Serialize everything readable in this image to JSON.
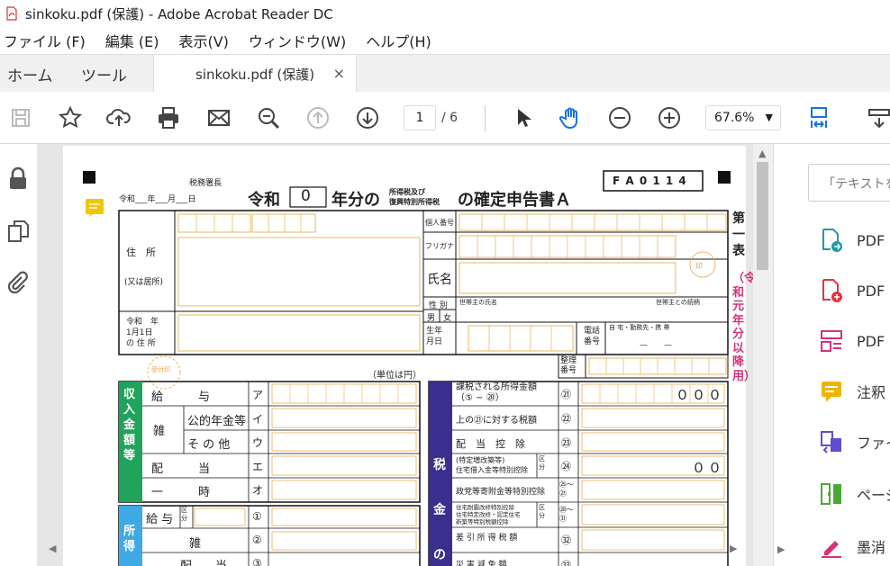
{
  "window": {
    "title": "sinkoku.pdf (保護) - Adobe Acrobat Reader DC"
  },
  "menu": [
    "ファイル (F)",
    "編集 (E)",
    "表示(V)",
    "ウィンドウ(W)",
    "ヘルプ(H)"
  ],
  "tabs": {
    "home": "ホーム",
    "tools": "ツール",
    "doc": "sinkoku.pdf (保護)",
    "close": "×"
  },
  "toolbar": {
    "page_current": "1",
    "page_total": "/ 6",
    "zoom": "67.6%",
    "zoom_arrow": "▼"
  },
  "right_panel": {
    "search_placeholder": "「テキストを",
    "items": [
      {
        "label": "PDF",
        "color": "#1e9aa6"
      },
      {
        "label": "PDF",
        "color": "#e0363f"
      },
      {
        "label": "PDF",
        "color": "#d6307a"
      },
      {
        "label": "注釈",
        "color": "#f0b400"
      },
      {
        "label": "ファイ",
        "color": "#5c4fcf"
      },
      {
        "label": "ページ",
        "color": "#4aa935"
      },
      {
        "label": "墨消",
        "color": "#d6307a"
      }
    ]
  },
  "form": {
    "code": "F A 0 1 1 4",
    "tax_office_head": "税務署長",
    "date_line": "令和___年___月___日",
    "title_reiwa": "令和",
    "title_year": "0",
    "title_main": "年分の",
    "title_small_1": "所得税及び",
    "title_small_2": "復興特別所得税",
    "title_end": "の確定申告書Ａ",
    "side_title": "第一表",
    "side_note": "（令和元年分以降用）",
    "address_label": "住　所",
    "address_sub": "(又は居所)",
    "jan1_label": "令和　年\n1月1日\nの 住 所",
    "mynumber": "個人番号",
    "furigana": "フリガナ",
    "name": "氏名",
    "sex": "性 別",
    "male": "男",
    "female": "女",
    "head_name": "世帯主の氏名",
    "relation": "世帯主との続柄",
    "birth": "生年\n月日",
    "phone": "電話\n番号",
    "phone_sub": "自 宅・勤務先・携 帯",
    "phone_dash": "—　　—",
    "seiri": "整理\n番号",
    "unit": "（単位は円）",
    "income_section": "収入金額等",
    "income_rows": [
      {
        "label": "給　　　与",
        "mark": "ア"
      },
      {
        "label": "公的年金等",
        "mark": "イ"
      },
      {
        "label": "そ の 他",
        "mark": "ウ"
      },
      {
        "label": "配　　　当",
        "mark": "エ"
      },
      {
        "label": "一　　　時",
        "mark": "オ"
      }
    ],
    "misc_label": "雑",
    "shotoku_section": "所得",
    "shotoku_rows": [
      {
        "label": "給 与",
        "mark": "①"
      },
      {
        "label": "雑",
        "mark": "②"
      },
      {
        "label": "配　　当",
        "mark": "③"
      }
    ],
    "tax_section": "税金の",
    "tax_rows": [
      {
        "label": "課税される所得金額\n（⑤ − ⑳）",
        "mark": "㉑",
        "value": "０００"
      },
      {
        "label": "上の㉑に対する税額",
        "mark": "㉒",
        "value": ""
      },
      {
        "label": "配　当　控　除",
        "mark": "㉓",
        "value": ""
      },
      {
        "label": "(特定増改築等)\n住宅借入金等特別控除",
        "mark": "㉔",
        "value": "００"
      },
      {
        "label": "政党等寄附金等特別控除",
        "mark": "㉕〜㉗",
        "value": ""
      },
      {
        "label": "住宅耐震改修特別控除\n住宅特定改修・認定住宅\n新築等特別税額控除",
        "mark": "㉘〜㉛",
        "value": ""
      },
      {
        "label": "差 引 所 得 税 額",
        "mark": "㉜",
        "value": ""
      },
      {
        "label": "災 害 減 免 額",
        "mark": "㉝",
        "value": ""
      }
    ],
    "ku": "区\n分",
    "stamp": "印",
    "receipt": "受付印"
  }
}
